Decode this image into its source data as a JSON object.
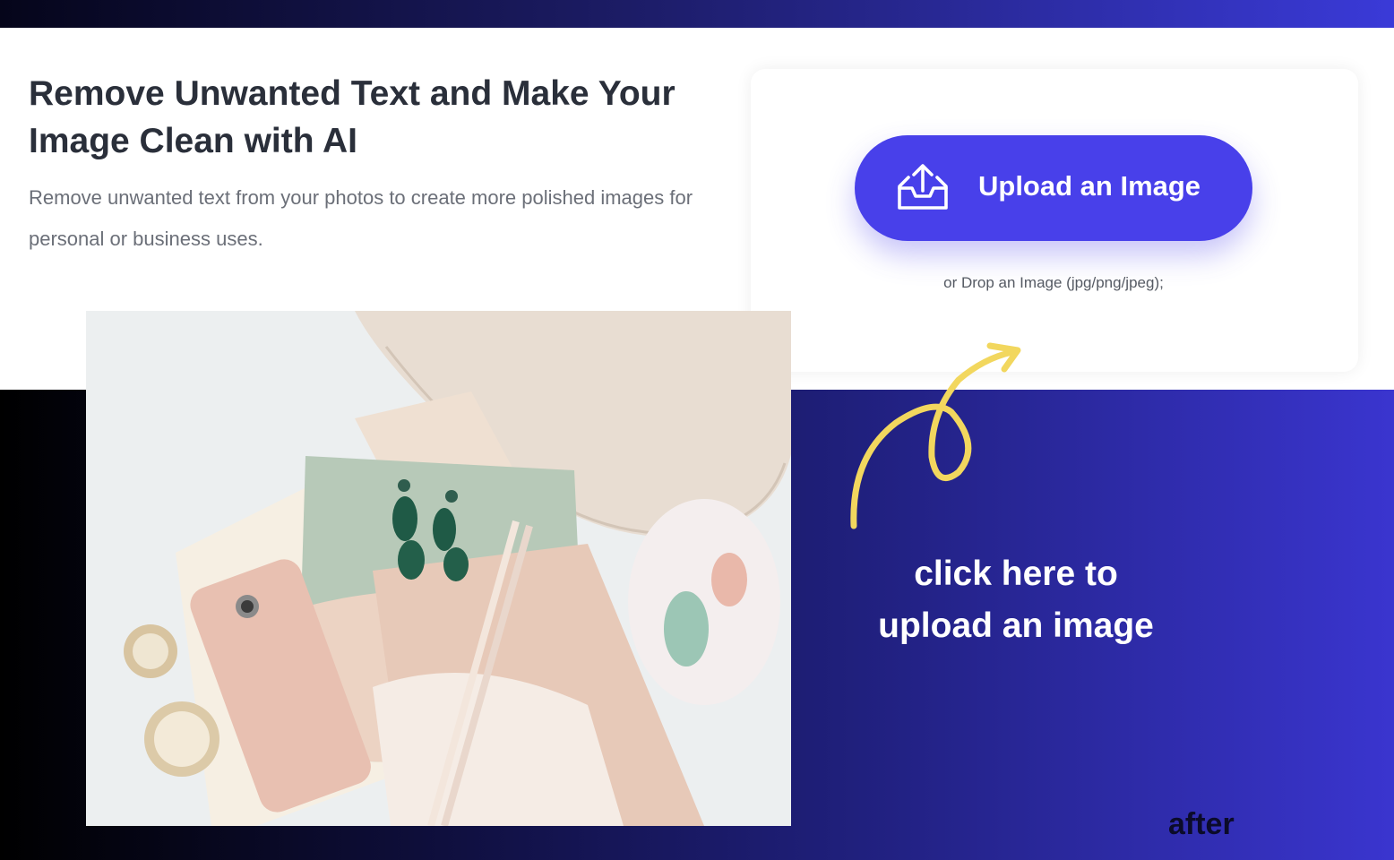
{
  "hero": {
    "headline": "Remove Unwanted Text and Make Your Image Clean with AI",
    "subtext": "Remove unwanted text from your photos to create more polished images for personal or business uses."
  },
  "upload": {
    "button_label": "Upload an Image",
    "button_icon": "upload-tray-icon",
    "drop_hint": "or Drop an Image (jpg/png/jpeg);"
  },
  "annotation": {
    "callout": "click here to upload an image",
    "after_label": "after",
    "arrow_icon": "curved-arrow-icon"
  },
  "colors": {
    "button": "#4840ea",
    "arrow": "#f2d75e",
    "heading": "#2a2f3a",
    "body_text": "#6b6f78",
    "band_dark": "#000000",
    "band_purple": "#3a35cf"
  }
}
